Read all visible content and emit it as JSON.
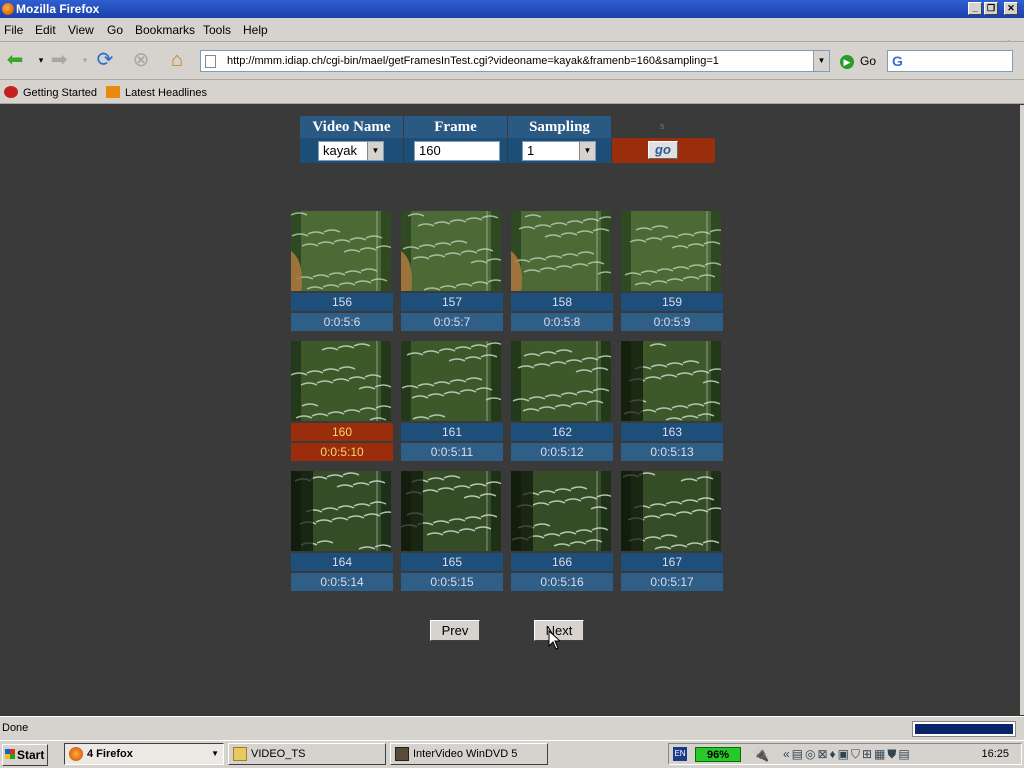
{
  "window": {
    "title": "Mozilla Firefox"
  },
  "menu": [
    "File",
    "Edit",
    "View",
    "Go",
    "Bookmarks",
    "Tools",
    "Help"
  ],
  "nav": {
    "url": "http://mmm.idiap.ch/cgi-bin/mael/getFramesInTest.cgi?videoname=kayak&framenb=160&sampling=1",
    "go_label": "Go"
  },
  "bookmarks": [
    "Getting Started",
    "Latest Headlines"
  ],
  "form": {
    "headers": [
      "Video Name",
      "Frame",
      "Sampling"
    ],
    "video_name": "kayak",
    "frame": "160",
    "sampling": "1",
    "go_label": "go",
    "small_text": "s"
  },
  "frames": [
    {
      "num": "156",
      "time": "0:0:5:6"
    },
    {
      "num": "157",
      "time": "0:0:5:7"
    },
    {
      "num": "158",
      "time": "0:0:5:8"
    },
    {
      "num": "159",
      "time": "0:0:5:9"
    },
    {
      "num": "160",
      "time": "0:0:5:10"
    },
    {
      "num": "161",
      "time": "0:0:5:11"
    },
    {
      "num": "162",
      "time": "0:0:5:12"
    },
    {
      "num": "163",
      "time": "0:0:5:13"
    },
    {
      "num": "164",
      "time": "0:0:5:14"
    },
    {
      "num": "165",
      "time": "0:0:5:15"
    },
    {
      "num": "166",
      "time": "0:0:5:16"
    },
    {
      "num": "167",
      "time": "0:0:5:17"
    }
  ],
  "selected_frame": "160",
  "pager": {
    "prev": "Prev",
    "next": "Next"
  },
  "status": {
    "text": "Done"
  },
  "taskbar": {
    "start": "Start",
    "tasks": [
      "4 Firefox",
      "VIDEO_TS",
      "InterVideo WinDVD 5"
    ],
    "battery": "96%",
    "lang": "EN",
    "clock": "16:25"
  },
  "colors": {
    "header_bg": "#2a5a84",
    "selected_bg": "#9a2e0c",
    "page_bg": "#3a3a3a"
  }
}
